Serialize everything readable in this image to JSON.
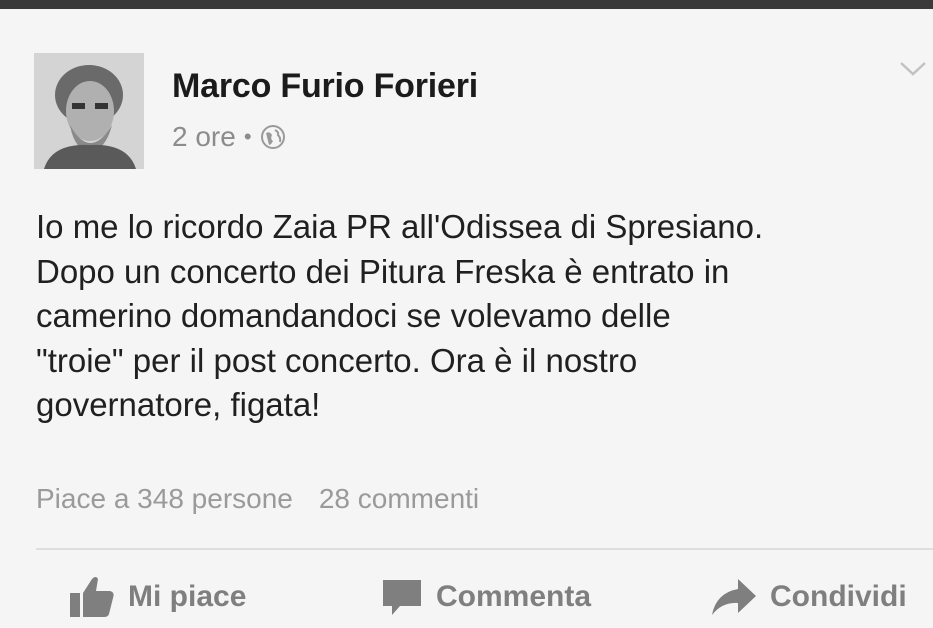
{
  "post": {
    "author": "Marco Furio Forieri",
    "time": "2 ore",
    "separator": "•",
    "privacy_icon": "globe-icon",
    "text": "Io me lo ricordo Zaia PR all'Odissea di Spresiano.\nDopo un concerto dei Pitura Freska è entrato in\ncamerino domandandoci se volevamo delle\n\"troie\" per il post concerto. Ora è il nostro\ngovernatore, figata!"
  },
  "stats": {
    "likes": "Piace a 348 persone",
    "comments": "28 commenti"
  },
  "actions": {
    "like_label": "Mi piace",
    "comment_label": "Commenta",
    "share_label": "Condividi"
  },
  "colors": {
    "text": "#202020",
    "muted": "#8c8c8c",
    "action": "#7f7f7f"
  }
}
